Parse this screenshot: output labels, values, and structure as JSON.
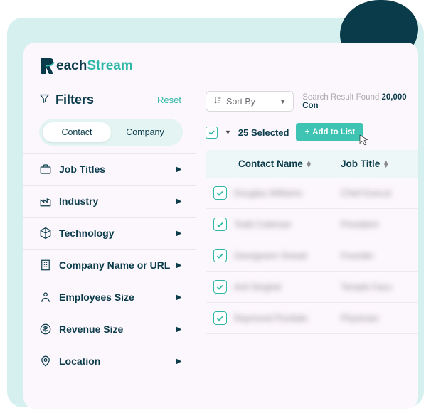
{
  "brand": {
    "part1": "each",
    "part2": "Stream"
  },
  "filters": {
    "heading": "Filters",
    "reset": "Reset",
    "tabs": {
      "contact": "Contact",
      "company": "Company"
    },
    "items": [
      {
        "label": "Job Titles",
        "icon": "briefcase"
      },
      {
        "label": "Industry",
        "icon": "factory"
      },
      {
        "label": "Technology",
        "icon": "cube"
      },
      {
        "label": "Company Name or URL",
        "icon": "building"
      },
      {
        "label": "Employees Size",
        "icon": "person"
      },
      {
        "label": "Revenue Size",
        "icon": "dollar"
      },
      {
        "label": "Location",
        "icon": "pin"
      }
    ]
  },
  "sort": {
    "label": "Sort By"
  },
  "search": {
    "prefix": "Search Result Found ",
    "count": "20,000 Con"
  },
  "selection": {
    "count": "25 Selected",
    "add": "Add to List"
  },
  "table": {
    "columns": {
      "name": "Contact Name",
      "title": "Job Title"
    },
    "rows": [
      {
        "name": "Douglas Williams",
        "title": "Chief Execut"
      },
      {
        "name": "Todd Coleman",
        "title": "President"
      },
      {
        "name": "Georgeann Snead",
        "title": "Founder"
      },
      {
        "name": "Anil Singhal",
        "title": "Temple Facu"
      },
      {
        "name": "Raymond Pizzitalo",
        "title": "Physician"
      }
    ]
  }
}
